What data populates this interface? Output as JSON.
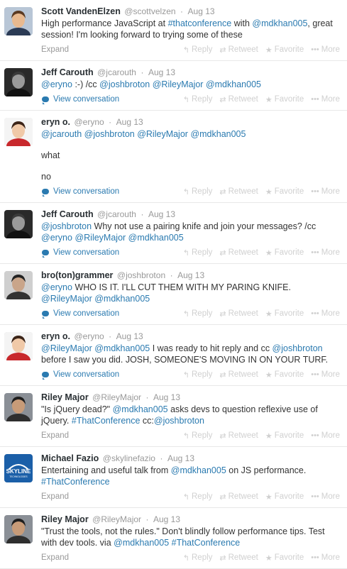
{
  "tweets": [
    {
      "name": "Scott VandenElzen",
      "handle": "@scottvelzen",
      "time": "Aug 13",
      "paragraphs": [
        [
          {
            "t": "High performance JavaScript at "
          },
          {
            "t": "#thatconference",
            "link": true
          },
          {
            "t": " with "
          },
          {
            "t": "@mdkhan005",
            "link": true
          },
          {
            "t": ", great session!  I'm looking forward to trying some of these"
          }
        ]
      ],
      "footer": "Expand",
      "conversation": false,
      "avatar": {
        "bg": "#b8c6d6",
        "skin": "#e8b98f",
        "hair": "#5a3a22",
        "shirt": "#2b3b55"
      }
    },
    {
      "name": "Jeff Carouth",
      "handle": "@jcarouth",
      "time": "Aug 13",
      "paragraphs": [
        [
          {
            "t": "@eryno",
            "link": true
          },
          {
            "t": " :-) /cc "
          },
          {
            "t": "@joshbroton",
            "link": true
          },
          {
            "t": " "
          },
          {
            "t": "@RileyMajor",
            "link": true
          },
          {
            "t": " "
          },
          {
            "t": "@mdkhan005",
            "link": true
          }
        ]
      ],
      "footer": "View conversation",
      "conversation": true,
      "avatar": {
        "bg": "#2a2a2a",
        "skin": "#9a9a9a",
        "hair": "#3a3a3a",
        "shirt": "#111111"
      }
    },
    {
      "name": "eryn o.",
      "handle": "@eryno",
      "time": "Aug 13",
      "paragraphs": [
        [
          {
            "t": "@jcarouth",
            "link": true
          },
          {
            "t": " "
          },
          {
            "t": "@joshbroton",
            "link": true
          },
          {
            "t": " "
          },
          {
            "t": "@RileyMajor",
            "link": true
          },
          {
            "t": " "
          },
          {
            "t": "@mdkhan005",
            "link": true
          }
        ],
        [
          {
            "t": "what"
          }
        ],
        [
          {
            "t": "no"
          }
        ]
      ],
      "footer": "View conversation",
      "conversation": true,
      "avatar": {
        "bg": "#f4f4f4",
        "skin": "#f0c9a8",
        "hair": "#3b2418",
        "shirt": "#c8282c"
      }
    },
    {
      "name": "Jeff Carouth",
      "handle": "@jcarouth",
      "time": "Aug 13",
      "paragraphs": [
        [
          {
            "t": "@joshbroton",
            "link": true
          },
          {
            "t": " Why not use a pairing knife and join your messages? /cc "
          },
          {
            "t": "@eryno",
            "link": true
          },
          {
            "t": " "
          },
          {
            "t": "@RileyMajor",
            "link": true
          },
          {
            "t": " "
          },
          {
            "t": "@mdkhan005",
            "link": true
          }
        ]
      ],
      "footer": "View conversation",
      "conversation": true,
      "avatar": {
        "bg": "#2a2a2a",
        "skin": "#9a9a9a",
        "hair": "#3a3a3a",
        "shirt": "#111111"
      }
    },
    {
      "name": "bro(ton)grammer",
      "handle": "@joshbroton",
      "time": "Aug 13",
      "paragraphs": [
        [
          {
            "t": "@eryno",
            "link": true
          },
          {
            "t": " WHO IS IT. I'LL CUT THEM WITH MY PARING KNIFE. "
          },
          {
            "t": "@RileyMajor",
            "link": true
          },
          {
            "t": " "
          },
          {
            "t": "@mdkhan005",
            "link": true
          }
        ]
      ],
      "footer": "View conversation",
      "conversation": true,
      "avatar": {
        "bg": "#cfcfcf",
        "skin": "#c9a58a",
        "hair": "#222222",
        "shirt": "#333333"
      }
    },
    {
      "name": "eryn o.",
      "handle": "@eryno",
      "time": "Aug 13",
      "paragraphs": [
        [
          {
            "t": "@RileyMajor",
            "link": true
          },
          {
            "t": " "
          },
          {
            "t": "@mdkhan005",
            "link": true
          },
          {
            "t": " I was ready to hit reply and cc "
          },
          {
            "t": "@joshbroton",
            "link": true
          },
          {
            "t": " before I saw you did. JOSH, SOMEONE'S MOVING IN ON YOUR TURF."
          }
        ]
      ],
      "footer": "View conversation",
      "conversation": true,
      "avatar": {
        "bg": "#f4f4f4",
        "skin": "#f0c9a8",
        "hair": "#3b2418",
        "shirt": "#c8282c"
      }
    },
    {
      "name": "Riley Major",
      "handle": "@RileyMajor",
      "time": "Aug 13",
      "paragraphs": [
        [
          {
            "t": "\"Is jQuery dead?\"  "
          },
          {
            "t": "@mdkhan005",
            "link": true
          },
          {
            "t": " asks devs to question reflexive use of jQuery. "
          },
          {
            "t": "#ThatConference",
            "link": true
          },
          {
            "t": "  cc:"
          },
          {
            "t": "@joshbroton",
            "link": true
          }
        ]
      ],
      "footer": "Expand",
      "conversation": false,
      "avatar": {
        "bg": "#8a8f96",
        "skin": "#c79b78",
        "hair": "#1e1e1e",
        "shirt": "#2e2e2e"
      }
    },
    {
      "name": "Michael Fazio",
      "handle": "@skylinefazio",
      "time": "Aug 13",
      "paragraphs": [
        [
          {
            "t": "Entertaining and useful talk from "
          },
          {
            "t": "@mdkhan005",
            "link": true
          },
          {
            "t": " on JS performance. "
          },
          {
            "t": "#ThatConference",
            "link": true
          }
        ]
      ],
      "footer": "Expand",
      "conversation": false,
      "logo": {
        "text": "SKYLINE",
        "sub": "TECHNOLOGIES",
        "bg": "#1b5fa8"
      }
    },
    {
      "name": "Riley Major",
      "handle": "@RileyMajor",
      "time": "Aug 13",
      "paragraphs": [
        [
          {
            "t": "\"Trust the tools, not the rules.\" Don't blindly follow performance tips. Test with dev tools. via "
          },
          {
            "t": "@mdkhan005",
            "link": true
          },
          {
            "t": " "
          },
          {
            "t": "#ThatConference",
            "link": true
          }
        ]
      ],
      "footer": "Expand",
      "conversation": false,
      "avatar": {
        "bg": "#8a8f96",
        "skin": "#c79b78",
        "hair": "#1e1e1e",
        "shirt": "#2e2e2e"
      }
    }
  ],
  "actions": {
    "reply": "Reply",
    "retweet": "Retweet",
    "favorite": "Favorite",
    "more": "More",
    "icons": {
      "reply": "reply-arrow-icon",
      "retweet": "retweet-icon",
      "favorite": "star-icon",
      "more": "dots-icon"
    }
  },
  "colors": {
    "link": "#2a7ab0",
    "muted": "#999999",
    "action": "#d0d0d0"
  }
}
